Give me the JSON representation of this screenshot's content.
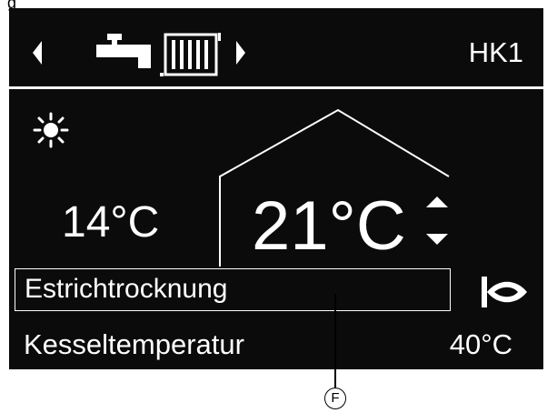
{
  "caption": "g",
  "header": {
    "circuit_label": "HK1",
    "icons": [
      "chevron-left-icon",
      "tap-icon",
      "radiator-icon",
      "chevron-right-icon"
    ]
  },
  "main": {
    "outdoor_temperature": "14°C",
    "room_temperature": "21°C",
    "mode_icon": "sun-icon",
    "adjust_icon": "up-down-arrows-icon"
  },
  "status": {
    "program": "Estrichtrocknung",
    "program_icon": "burner-flame-icon"
  },
  "footer": {
    "label": "Kesseltemperatur",
    "value": "40°C"
  },
  "callout": {
    "marker": "F"
  },
  "colors": {
    "screen_background": "#0b0b0b",
    "foreground": "#ffffff"
  }
}
